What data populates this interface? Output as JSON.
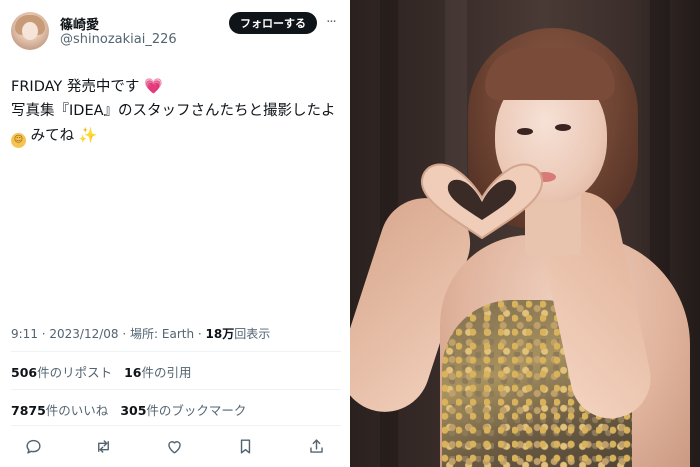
{
  "tweet": {
    "display_name": "篠崎愛",
    "handle": "@shinozakiai_226",
    "follow_label": "フォローする",
    "more_label": "···",
    "body_lines": [
      "FRIDAY 発売中です",
      "写真集『IDEA』のスタッフさんたちと撮影したよ",
      "みてね"
    ],
    "emoji": {
      "heart": "💗",
      "smile": "☺",
      "sparkle": "✨"
    },
    "meta": {
      "time_date": "9:11 · 2023/12/08",
      "location_label": "場所: Earth",
      "views_sep": " · ",
      "views_count": "18万",
      "views_label": "回表示"
    },
    "stats": {
      "reposts_count": "506",
      "reposts_label": "件のリポスト",
      "quotes_count": "16",
      "quotes_label": "件の引用",
      "likes_count": "7875",
      "likes_label": "件のいいね",
      "bookmarks_count": "305",
      "bookmarks_label": "件のブックマーク"
    },
    "actions": [
      "reply-icon",
      "repost-icon",
      "like-icon",
      "bookmark-icon",
      "share-icon"
    ]
  },
  "colors": {
    "text_primary": "#0f1419",
    "text_secondary": "#536471",
    "follow_button_bg": "#0f1419",
    "divider": "#eff3f4"
  }
}
